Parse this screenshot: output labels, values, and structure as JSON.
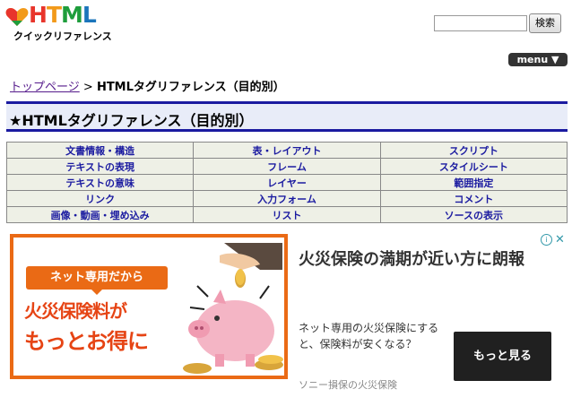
{
  "logo": {
    "wordmark": [
      "H",
      "T",
      "M",
      "L"
    ],
    "subtitle": "クイックリファレンス"
  },
  "search": {
    "value": "",
    "placeholder": "",
    "button_label": "検索"
  },
  "menu": {
    "label": "menu ▼"
  },
  "breadcrumb": {
    "home": "トップページ",
    "separator": ">",
    "current": "HTMLタグリファレンス（目的別）"
  },
  "page": {
    "title": "★HTMLタグリファレンス（目的別）"
  },
  "nav": {
    "rows": [
      [
        "文書情報・構造",
        "表・レイアウト",
        "スクリプト"
      ],
      [
        "テキストの表現",
        "フレーム",
        "スタイルシート"
      ],
      [
        "テキストの意味",
        "レイヤー",
        "範囲指定"
      ],
      [
        "リンク",
        "入力フォーム",
        "コメント"
      ],
      [
        "画像・動画・埋め込み",
        "リスト",
        "ソースの表示"
      ]
    ]
  },
  "ad": {
    "badge": "ネット専用だから",
    "main_line1": "火災保険料が",
    "main_line2": "もっとお得に",
    "headline": "火災保険の満期が近い方に朗報",
    "body": "ネット専用の火災保険にすると、保険料が安くなる？",
    "source": "ソニー損保の火災保険",
    "cta": "もっと見る",
    "info_icon": "ⓘ",
    "close_icon": "✕"
  },
  "colors": {
    "accent": "#1a1aa0",
    "ad_orange": "#ea6a15"
  }
}
